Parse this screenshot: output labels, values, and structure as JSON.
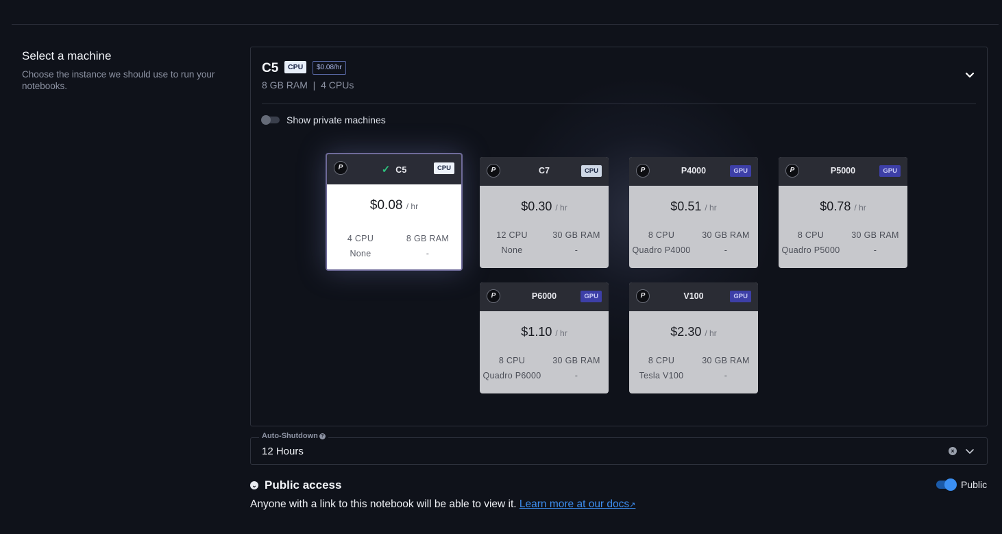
{
  "section": {
    "title": "Select a machine",
    "description": "Choose the instance we should use to run your notebooks."
  },
  "current": {
    "name": "C5",
    "type": "CPU",
    "price": "$0.08/hr",
    "specs": "8 GB RAM  |  4 CPUs"
  },
  "private_toggle": {
    "label": "Show private machines",
    "on": false
  },
  "machines": [
    {
      "name": "C5",
      "type": "CPU",
      "price": "$0.08",
      "unit": "/ hr",
      "cpu": "4 CPU",
      "ram": "8 GB RAM",
      "gpu": "None",
      "gpu_mem": "-",
      "selected": true
    },
    {
      "name": "C7",
      "type": "CPU",
      "price": "$0.30",
      "unit": "/ hr",
      "cpu": "12 CPU",
      "ram": "30 GB RAM",
      "gpu": "None",
      "gpu_mem": "-"
    },
    {
      "name": "P4000",
      "type": "GPU",
      "price": "$0.51",
      "unit": "/ hr",
      "cpu": "8 CPU",
      "ram": "30 GB RAM",
      "gpu": "Quadro P4000",
      "gpu_mem": "-"
    },
    {
      "name": "P5000",
      "type": "GPU",
      "price": "$0.78",
      "unit": "/ hr",
      "cpu": "8 CPU",
      "ram": "30 GB RAM",
      "gpu": "Quadro P5000",
      "gpu_mem": "-"
    },
    {
      "name": "P6000",
      "type": "GPU",
      "price": "$1.10",
      "unit": "/ hr",
      "cpu": "8 CPU",
      "ram": "30 GB RAM",
      "gpu": "Quadro P6000",
      "gpu_mem": "-"
    },
    {
      "name": "V100",
      "type": "GPU",
      "price": "$2.30",
      "unit": "/ hr",
      "cpu": "8 CPU",
      "ram": "30 GB RAM",
      "gpu": "Tesla V100",
      "gpu_mem": "-"
    }
  ],
  "auto_shutdown": {
    "label": "Auto-Shutdown",
    "value": "12 Hours"
  },
  "public_access": {
    "title": "Public access",
    "toggle_label": "Public",
    "on": true,
    "description": "Anyone with a link to this notebook will be able to view it.",
    "link_text": "Learn more at our docs"
  },
  "colors": {
    "accent": "#3b8ff2",
    "gpu_badge": "#3d3fa7",
    "check": "#2ec27e",
    "background": "#0f121a"
  }
}
